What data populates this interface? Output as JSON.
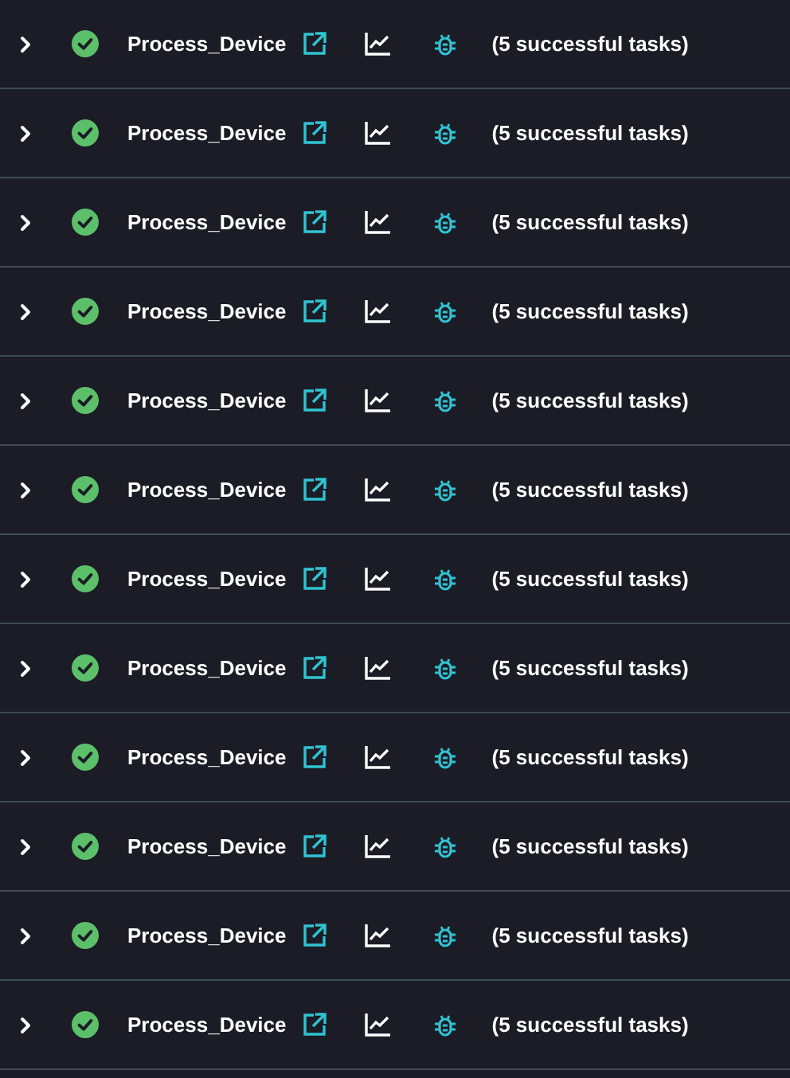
{
  "runs": [
    {
      "expanded": false,
      "kind": "success",
      "name": "Process_Device",
      "summary": "(5 successful tasks)"
    },
    {
      "expanded": false,
      "kind": "success",
      "name": "Process_Device",
      "summary": "(5 successful tasks)"
    },
    {
      "expanded": false,
      "kind": "success",
      "name": "Process_Device",
      "summary": "(5 successful tasks)"
    },
    {
      "expanded": false,
      "kind": "success",
      "name": "Process_Device",
      "summary": "(5 successful tasks)"
    },
    {
      "expanded": false,
      "kind": "success",
      "name": "Process_Device",
      "summary": "(5 successful tasks)"
    },
    {
      "expanded": false,
      "kind": "success",
      "name": "Process_Device",
      "summary": "(5 successful tasks)"
    },
    {
      "expanded": false,
      "kind": "success",
      "name": "Process_Device",
      "summary": "(5 successful tasks)"
    },
    {
      "expanded": false,
      "kind": "success",
      "name": "Process_Device",
      "summary": "(5 successful tasks)"
    },
    {
      "expanded": false,
      "kind": "success",
      "name": "Process_Device",
      "summary": "(5 successful tasks)"
    },
    {
      "expanded": false,
      "kind": "success",
      "name": "Process_Device",
      "summary": "(5 successful tasks)"
    },
    {
      "expanded": false,
      "kind": "success",
      "name": "Process_Device",
      "summary": "(5 successful tasks)"
    },
    {
      "expanded": false,
      "kind": "success",
      "name": "Process_Device",
      "summary": "(5 successful tasks)"
    }
  ]
}
